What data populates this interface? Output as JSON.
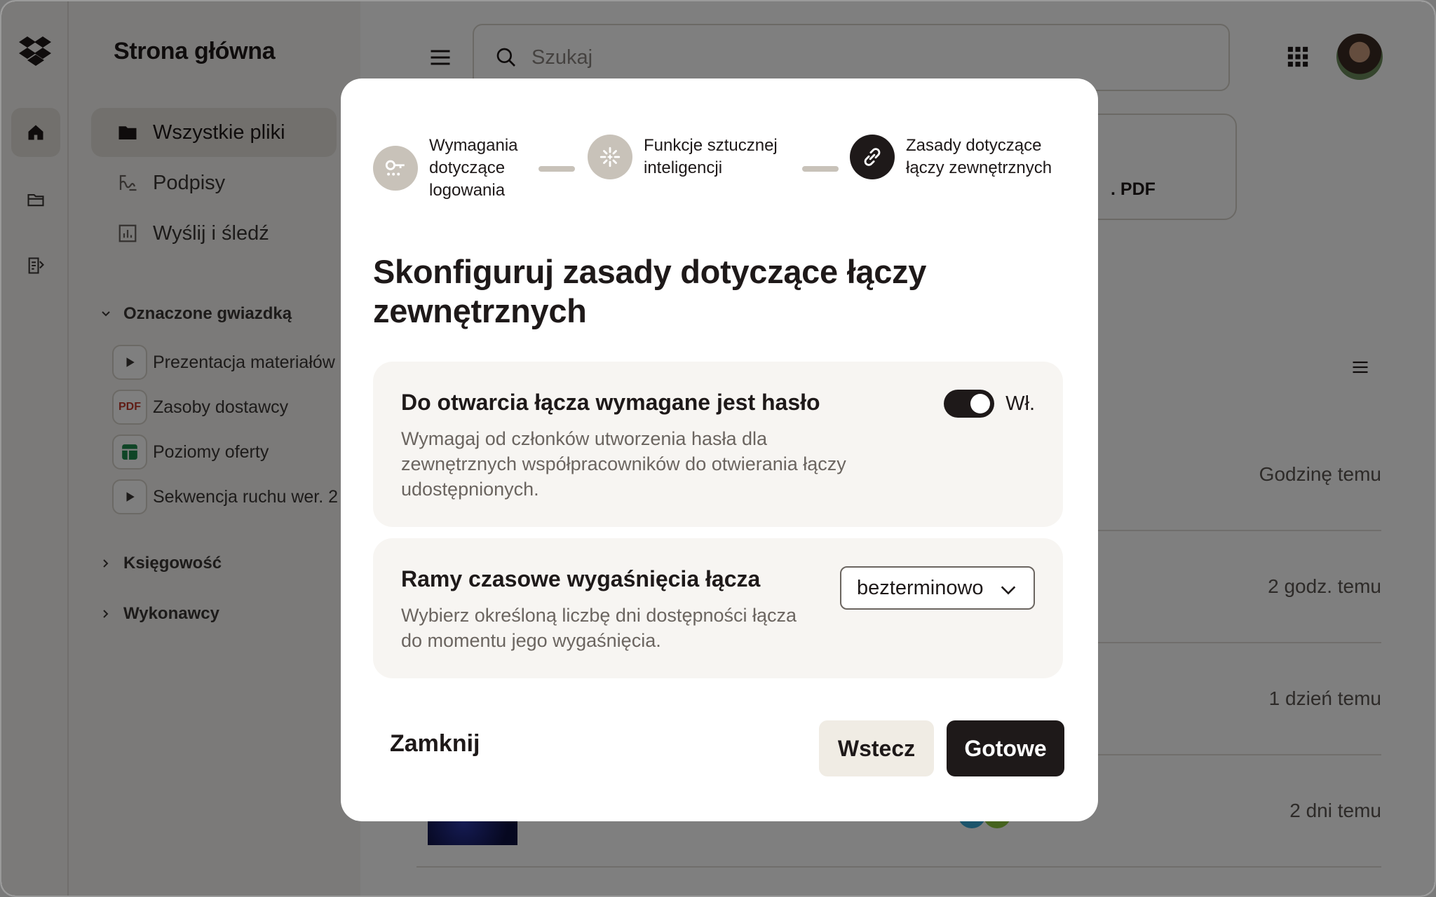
{
  "sidebar": {
    "title": "Strona główna",
    "nav": [
      {
        "label": "Wszystkie pliki",
        "icon": "folder-icon"
      },
      {
        "label": "Podpisy",
        "icon": "signature-icon"
      },
      {
        "label": "Wyślij i śledź",
        "icon": "chart-icon"
      }
    ],
    "starred_header": "Oznaczone gwiazdką",
    "starred": [
      {
        "label": "Prezentacja materiałów",
        "icon": "play-icon"
      },
      {
        "label": "Zasoby dostawcy",
        "icon": "pdf-icon",
        "badge": "PDF"
      },
      {
        "label": "Poziomy oferty",
        "icon": "sheet-icon"
      },
      {
        "label": "Sekwencja ruchu wer. 2",
        "icon": "play-icon"
      }
    ],
    "sections": [
      "Księgowość",
      "Wykonawcy"
    ]
  },
  "header": {
    "search_placeholder": "Szukaj"
  },
  "main": {
    "card_tail_label": ". PDF",
    "rows": [
      {
        "time": "Godzinę temu"
      },
      {
        "time": "2 godz. temu"
      },
      {
        "time": "1 dzień temu"
      },
      {
        "time": "2 dni temu"
      }
    ]
  },
  "modal": {
    "steps": [
      {
        "label": "Wymagania dotyczące logowania",
        "icon": "key-icon",
        "state": "done"
      },
      {
        "label": "Funkcje sztucznej inteligencji",
        "icon": "ai-sparkle-icon",
        "state": "done"
      },
      {
        "label": "Zasady dotyczące łączy zewnętrznych",
        "icon": "link-icon",
        "state": "active"
      }
    ],
    "title": "Skonfiguruj zasady dotyczące łączy zewnętrznych",
    "password": {
      "title": "Do otwarcia łącza wymagane jest hasło",
      "desc": "Wymagaj od członków utworzenia hasła dla zewnętrznych współpracowników do otwierania łączy udostępnionych.",
      "toggle_label": "Wł.",
      "enabled": true
    },
    "expiry": {
      "title": "Ramy czasowe wygaśnięcia łącza",
      "desc": "Wybierz określoną liczbę dni dostępności łącza do momentu jego wygaśnięcia.",
      "selected": "bezterminowo"
    },
    "buttons": {
      "close": "Zamknij",
      "back": "Wstecz",
      "done": "Gotowe"
    }
  },
  "colors": {
    "dark": "#1e1919",
    "panel": "#f7f5f2",
    "step_inactive": "#c8c2b9",
    "back_button": "#f0ece4"
  }
}
